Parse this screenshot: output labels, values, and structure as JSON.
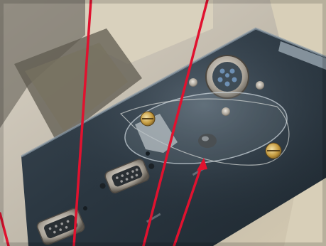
{
  "image": {
    "subject": "photo",
    "colors": {
      "background_wall": "#cfc6b4",
      "panel_dark": "#2d3a44",
      "panel_edge": "#8a9aa6",
      "connector_metal": "#b7b1a8",
      "screw_brass": "#c8a24a",
      "annotation_line": "#e0122f"
    }
  }
}
